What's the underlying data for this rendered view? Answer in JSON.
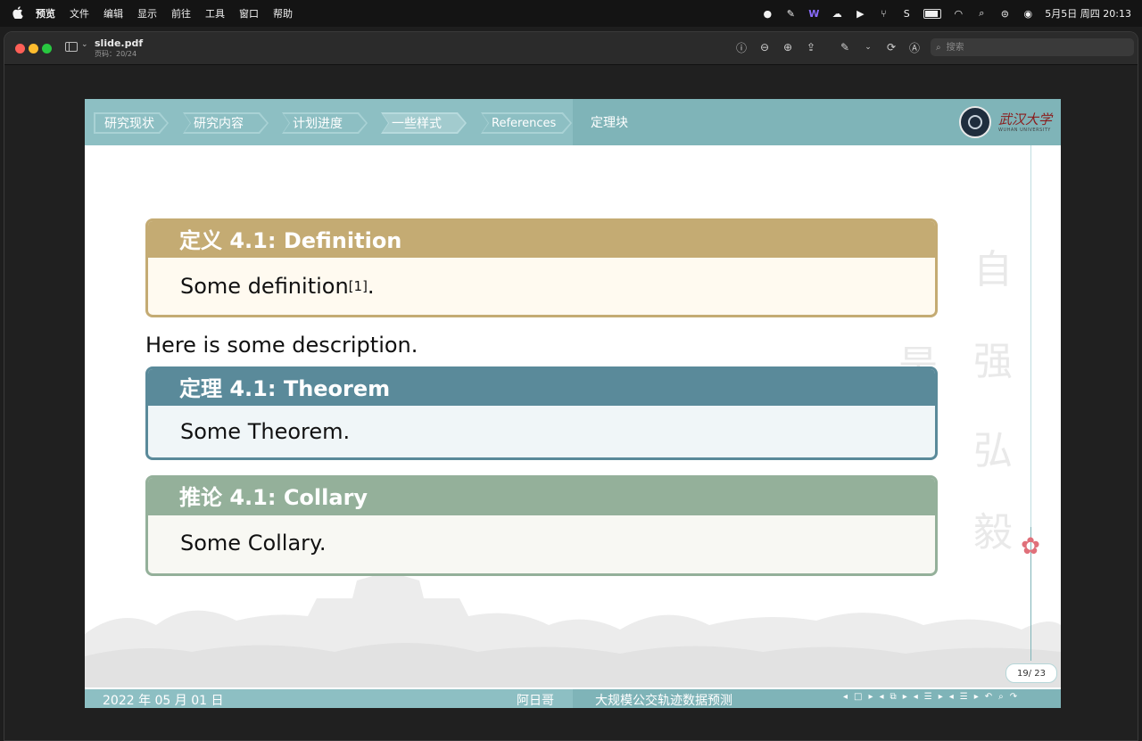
{
  "menubar": {
    "app_name": "预览",
    "items": [
      "文件",
      "编辑",
      "显示",
      "前往",
      "工具",
      "窗口",
      "帮助"
    ],
    "clock": "5月5日 周四  20:13"
  },
  "window": {
    "doc_title": "slide.pdf",
    "doc_subtitle": "页码：20/24",
    "search_placeholder": "搜索"
  },
  "slide": {
    "nav_tabs": [
      "研究现状",
      "研究内容",
      "计划进度",
      "一些样式",
      "References"
    ],
    "current_tab_index": 3,
    "subsection": "定理块",
    "university_name": "武汉大学",
    "university_en": "WUHAN UNIVERSITY",
    "motto": [
      "自",
      "强",
      "弘",
      "毅",
      "是"
    ],
    "definition": {
      "title": "定义 4.1: Definition",
      "body": "Some definition",
      "citation": "[1]",
      "after": "."
    },
    "description": "Here is some description.",
    "theorem": {
      "title": "定理 4.1: Theorem",
      "body": "Some Theorem."
    },
    "corollary": {
      "title": "推论 4.1: Collary",
      "body": "Some Collary."
    },
    "page_number": "19/ 23",
    "footer": {
      "date": "2022 年 05 月 01 日",
      "author": "阿日哥",
      "title": "大规模公交轨迹数据预测"
    },
    "colors": {
      "header": "#8dbfc3",
      "definition": "#c4ab73",
      "theorem": "#5a8a9a",
      "corollary": "#94b09a"
    }
  }
}
